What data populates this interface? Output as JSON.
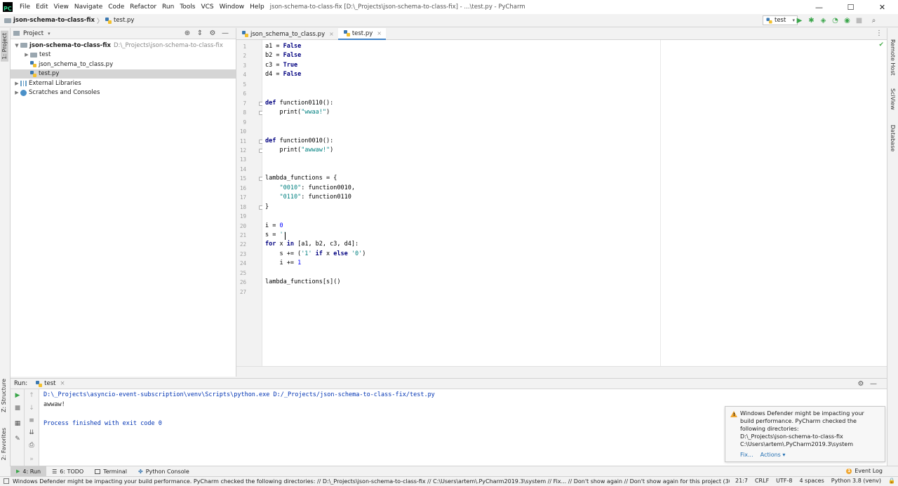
{
  "titlebar": {
    "app_logo": "PC",
    "menu": [
      "File",
      "Edit",
      "View",
      "Navigate",
      "Code",
      "Refactor",
      "Run",
      "Tools",
      "VCS",
      "Window",
      "Help"
    ],
    "window_title": "json-schema-to-class-fix [D:\\_Projects\\json-schema-to-class-fix] - ...\\test.py - PyCharm",
    "controls": {
      "minimize": "—",
      "maximize": "☐",
      "close": "✕"
    }
  },
  "navbar": {
    "project": "json-schema-to-class-fix",
    "file": "test.py",
    "run_config": "test",
    "icons": [
      "run-icon",
      "debug-icon",
      "coverage-icon",
      "profile-icon",
      "concurrency-icon",
      "stop-icon",
      "search-everywhere-icon"
    ]
  },
  "left_strip": {
    "project_tab": "1: Project",
    "structure_tab": "Z: Structure",
    "favorites_tab": "2: Favorites"
  },
  "right_strip": {
    "tabs": [
      "Remote Host",
      "SciView",
      "Database"
    ]
  },
  "project_panel": {
    "header": "Project",
    "tree": [
      {
        "label": "json-schema-to-class-fix",
        "path": "D:\\_Projects\\json-schema-to-class-fix",
        "type": "folder",
        "depth": 0,
        "expanded": true,
        "bold": true
      },
      {
        "label": "test",
        "type": "folder",
        "depth": 1,
        "expanded": false
      },
      {
        "label": "json_schema_to_class.py",
        "type": "py",
        "depth": 1
      },
      {
        "label": "test.py",
        "type": "py",
        "depth": 1,
        "selected": true
      },
      {
        "label": "External Libraries",
        "type": "lib",
        "depth": 0,
        "expanded": false
      },
      {
        "label": "Scratches and Consoles",
        "type": "scratch",
        "depth": 0,
        "expanded": false
      }
    ]
  },
  "editor": {
    "tabs": [
      {
        "label": "json_schema_to_class.py",
        "active": false
      },
      {
        "label": "test.py",
        "active": true
      }
    ],
    "caret_line": 21,
    "code": [
      [
        [
          "a1 = ",
          ""
        ],
        [
          "False",
          "kw"
        ]
      ],
      [
        [
          "b2 = ",
          ""
        ],
        [
          "False",
          "kw"
        ]
      ],
      [
        [
          "c3 = ",
          ""
        ],
        [
          "True",
          "kw"
        ]
      ],
      [
        [
          "d4 = ",
          ""
        ],
        [
          "False",
          "kw"
        ]
      ],
      [],
      [],
      [
        [
          "def",
          "kw"
        ],
        [
          " function0110():",
          ""
        ]
      ],
      [
        [
          "    print(",
          ""
        ],
        [
          "\"wwaa!\"",
          "str"
        ],
        [
          ")",
          ""
        ]
      ],
      [],
      [],
      [
        [
          "def",
          "kw"
        ],
        [
          " function0010():",
          ""
        ]
      ],
      [
        [
          "    print(",
          ""
        ],
        [
          "\"awwaw!\"",
          "str"
        ],
        [
          ")",
          ""
        ]
      ],
      [],
      [],
      [
        [
          "lambda_functions = {",
          ""
        ]
      ],
      [
        [
          "    ",
          ""
        ],
        [
          "\"0010\"",
          "str"
        ],
        [
          ": function0010,",
          ""
        ]
      ],
      [
        [
          "    ",
          ""
        ],
        [
          "\"0110\"",
          "str"
        ],
        [
          ": function0110",
          ""
        ]
      ],
      [
        [
          "}",
          ""
        ]
      ],
      [],
      [
        [
          "i = ",
          ""
        ],
        [
          "0",
          "num"
        ]
      ],
      [
        [
          "s = ",
          ""
        ],
        [
          "''",
          "str"
        ]
      ],
      [
        [
          "for",
          "kw"
        ],
        [
          " x ",
          ""
        ],
        [
          "in",
          "kw"
        ],
        [
          " [a1, b2, c3, d4]:",
          ""
        ]
      ],
      [
        [
          "    s += (",
          ""
        ],
        [
          "'1'",
          "str"
        ],
        [
          " ",
          ""
        ],
        [
          "if",
          "kw"
        ],
        [
          " x ",
          ""
        ],
        [
          "else",
          "kw"
        ],
        [
          " ",
          ""
        ],
        [
          "'0'",
          "str"
        ],
        [
          ")",
          ""
        ]
      ],
      [
        [
          "    i += ",
          ""
        ],
        [
          "1",
          "num"
        ]
      ],
      [],
      [
        [
          "lambda_functions[s]()",
          ""
        ]
      ],
      []
    ]
  },
  "run_panel": {
    "label": "Run:",
    "tab": "test",
    "console": [
      {
        "text": "D:\\_Projects\\asyncio-event-subscription\\venv\\Scripts\\python.exe D:/_Projects/json-schema-to-class-fix/test.py",
        "style": "blue"
      },
      {
        "text": "awwaw!",
        "style": "plain"
      },
      {
        "text": "",
        "style": "plain"
      },
      {
        "text": "Process finished with exit code 0",
        "style": "blue"
      }
    ]
  },
  "notification": {
    "lines": [
      "Windows Defender might be impacting your",
      "build performance. PyCharm checked the",
      "following directories:",
      "D:\\_Projects\\json-schema-to-class-fix",
      "C:\\Users\\artem\\.PyCharm2019.3\\system"
    ],
    "fix": "Fix...",
    "actions": "Actions ▾"
  },
  "bottom_tabs": {
    "run": "4: Run",
    "todo": "6: TODO",
    "terminal": "Terminal",
    "python_console": "Python Console",
    "event_log": "Event Log",
    "event_count": "1"
  },
  "statusbar": {
    "message": "Windows Defender might be impacting your build performance. PyCharm checked the following directories: // D:\\_Projects\\json-schema-to-class-fix // C:\\Users\\artem\\.PyCharm2019.3\\system // Fix... // Don't show again // Don't show again for this project (30 minutes ago)",
    "position": "21:7",
    "line_sep": "CRLF",
    "encoding": "UTF-8",
    "indent": "4 spaces",
    "interpreter": "Python 3.8 (venv)"
  },
  "colors": {
    "accent": "#4083c9",
    "keyword": "#000080",
    "string": "#008080",
    "number": "#0000ff",
    "caret_line": "#fcf9e3",
    "warning": "#f0a732"
  }
}
